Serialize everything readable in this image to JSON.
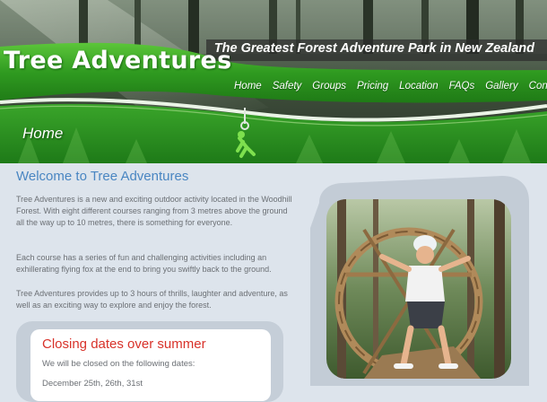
{
  "site": {
    "logo_text": "Tree Adventures",
    "tagline": "The Greatest Forest Adventure Park in New Zealand"
  },
  "nav": {
    "items": [
      {
        "label": "Home"
      },
      {
        "label": "Safety"
      },
      {
        "label": "Groups"
      },
      {
        "label": "Pricing"
      },
      {
        "label": "Location"
      },
      {
        "label": "FAQs"
      },
      {
        "label": "Gallery"
      },
      {
        "label": "Contact us"
      }
    ]
  },
  "page": {
    "heading": "Home"
  },
  "main": {
    "welcome_title": "Welcome to Tree Adventures",
    "paragraphs": [
      "Tree Adventures is a new and exciting outdoor activity located in the Woodhill Forest. With eight different courses ranging from 3 metres above the ground all the way up to 10 metres, there is something for everyone.",
      "Each course has a series of fun and challenging activities including an exhillerating flying fox at the end to bring you swiftly back to the ground.",
      "Tree Adventures provides up to 3 hours of thrills, laughter and adventure, as well as an exciting way to explore and enjoy the forest."
    ]
  },
  "closing": {
    "title": "Closing dates over summer",
    "text": "We will be closed on the following dates:",
    "dates": "December 25th, 26th, 31st"
  },
  "colors": {
    "brand_green": "#3aa52a",
    "link_blue": "#4a86c2",
    "alert_red": "#d8322a"
  }
}
